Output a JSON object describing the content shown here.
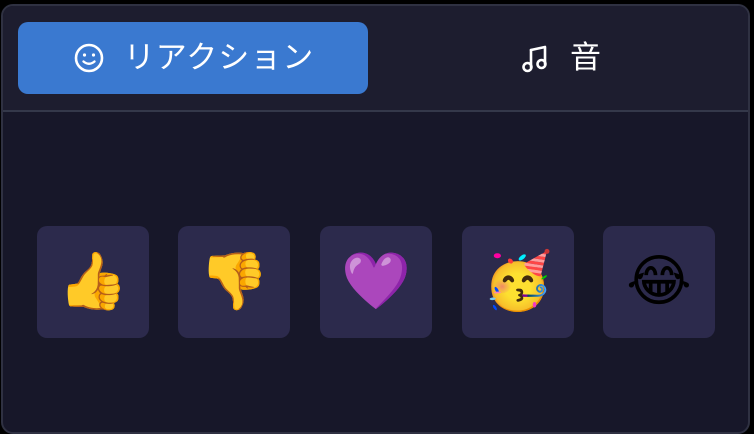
{
  "tabs": [
    {
      "label": "リアクション",
      "icon": "smile-icon",
      "active": true
    },
    {
      "label": "音",
      "icon": "music-note-icon",
      "active": false
    }
  ],
  "reactions": [
    {
      "name": "thumbs-up",
      "glyph": "👍"
    },
    {
      "name": "thumbs-down",
      "glyph": "👎"
    },
    {
      "name": "purple-heart",
      "glyph": "💜"
    },
    {
      "name": "party-face",
      "glyph": "🥳"
    },
    {
      "name": "tears-of-joy",
      "glyph": "😂"
    }
  ],
  "colors": {
    "background": "#171729",
    "tab_bar": "#1d1d2f",
    "active_tab": "#3a79d0",
    "reaction_tile": "#2c2a4c",
    "text": "#ffffff"
  }
}
